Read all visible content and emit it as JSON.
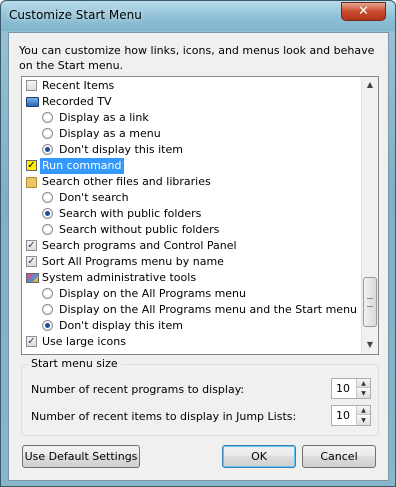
{
  "window": {
    "title": "Customize Start Menu",
    "close_glyph": "✕"
  },
  "intro": "You can customize how links, icons, and menus look and behave on the Start menu.",
  "list": {
    "items": [
      {
        "kind": "checkbox",
        "checked": false,
        "label": "Recent Items"
      },
      {
        "kind": "header",
        "icon": "tv-icon",
        "label": "Recorded TV"
      },
      {
        "kind": "radio",
        "checked": false,
        "label": "Display as a link"
      },
      {
        "kind": "radio",
        "checked": false,
        "label": "Display as a menu"
      },
      {
        "kind": "radio",
        "checked": true,
        "label": "Don't display this item"
      },
      {
        "kind": "checkbox",
        "checked": true,
        "highlighted": true,
        "selected": true,
        "label": "Run command"
      },
      {
        "kind": "header",
        "icon": "folder-icon",
        "label": "Search other files and libraries"
      },
      {
        "kind": "radio",
        "checked": false,
        "label": "Don't search"
      },
      {
        "kind": "radio",
        "checked": true,
        "label": "Search with public folders"
      },
      {
        "kind": "radio",
        "checked": false,
        "label": "Search without public folders"
      },
      {
        "kind": "checkbox",
        "checked": true,
        "label": "Search programs and Control Panel"
      },
      {
        "kind": "checkbox",
        "checked": true,
        "label": "Sort All Programs menu by name"
      },
      {
        "kind": "header",
        "icon": "admin-tools-icon",
        "label": "System administrative tools"
      },
      {
        "kind": "radio",
        "checked": false,
        "label": "Display on the All Programs menu"
      },
      {
        "kind": "radio",
        "checked": false,
        "label": "Display on the All Programs menu and the Start menu"
      },
      {
        "kind": "radio",
        "checked": true,
        "label": "Don't display this item"
      },
      {
        "kind": "checkbox",
        "checked": true,
        "label": "Use large icons"
      }
    ],
    "scroll_up_glyph": "▲",
    "scroll_down_glyph": "▼"
  },
  "size_group": {
    "title": "Start menu size",
    "recent_programs_label": "Number of recent programs to display:",
    "recent_programs_value": "10",
    "jump_list_label": "Number of recent items to display in Jump Lists:",
    "jump_list_value": "10",
    "spin_up_glyph": "▲",
    "spin_down_glyph": "▼"
  },
  "buttons": {
    "defaults": "Use Default Settings",
    "ok": "OK",
    "cancel": "Cancel"
  }
}
